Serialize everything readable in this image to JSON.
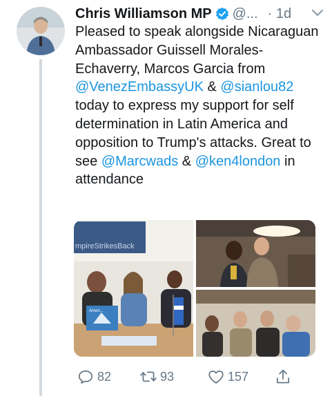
{
  "tweet": {
    "author_name": "Chris Williamson MP",
    "handle": "@...",
    "time": "· 1d",
    "text_segments": [
      {
        "text": "Pleased to speak alongside Nicaraguan Ambassador Guissell Morales-Echaverry, Marcos Garcia from ",
        "type": "plain"
      },
      {
        "text": "@VenezEmbassyUK",
        "type": "link"
      },
      {
        "text": " & ",
        "type": "plain"
      },
      {
        "text": "@sianlou82",
        "type": "link"
      },
      {
        "text": " today to express my support for self determination in Latin America and opposition to Trump's attacks. Great to see ",
        "type": "plain"
      },
      {
        "text": "@Marcwads",
        "type": "link"
      },
      {
        "text": " & ",
        "type": "plain"
      },
      {
        "text": "@ken4london",
        "type": "link"
      },
      {
        "text": " in attendance",
        "type": "plain"
      }
    ],
    "media": {
      "photo_banner_text": "mpireStrikesBack",
      "photo_sign_text": "Ameri..."
    },
    "actions": {
      "reply_count": "82",
      "retweet_count": "93",
      "like_count": "157"
    }
  },
  "colors": {
    "link": "#1b95e0",
    "secondary": "#657786",
    "verified": "#1da1f2",
    "thread_line": "#d3d9de"
  },
  "icons": [
    "verified-badge-icon",
    "chevron-down-icon",
    "reply-icon",
    "retweet-icon",
    "like-icon",
    "share-icon"
  ]
}
